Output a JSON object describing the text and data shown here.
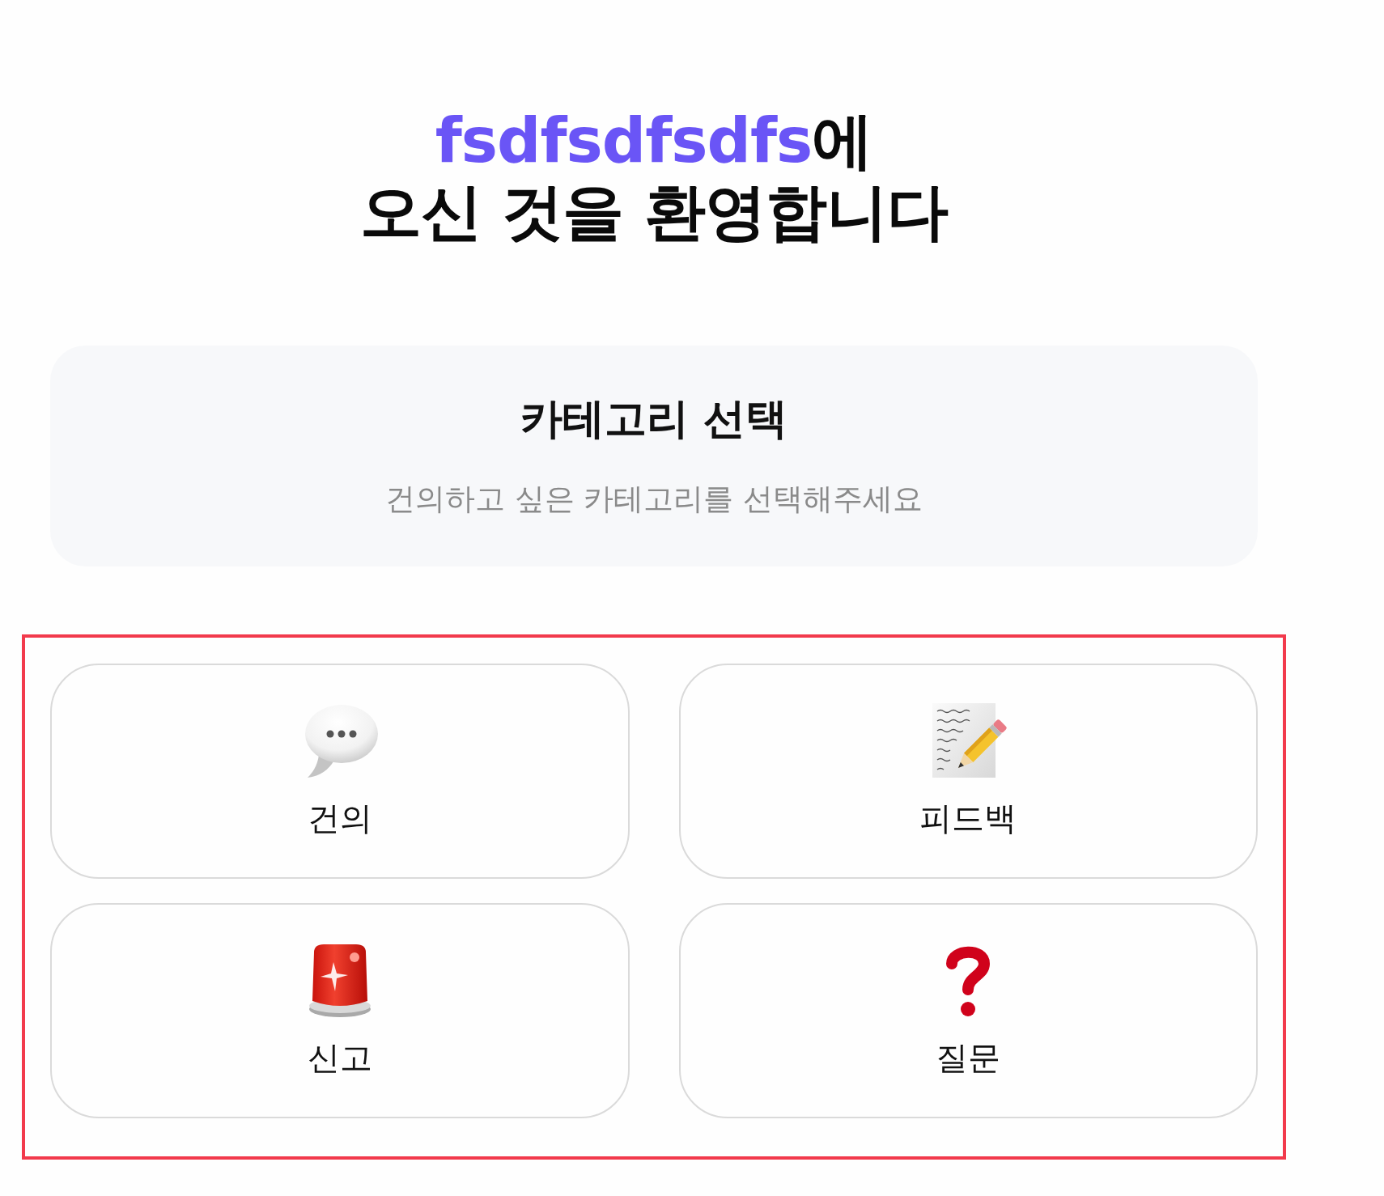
{
  "welcome": {
    "highlight": "fsdfsdfsdfs",
    "title_rest": "에",
    "title_line_2": "오신 것을 환영합니다"
  },
  "category_header": {
    "title": "카테고리 선택",
    "subtitle": "건의하고 싶은 카테고리를 선택해주세요"
  },
  "category_grid": {
    "highlighted": true,
    "categories": [
      {
        "label": "건의",
        "kind": "suggestion",
        "selected": false
      },
      {
        "label": "피드백",
        "kind": "feedback",
        "selected": false
      },
      {
        "label": "신고",
        "kind": "report",
        "selected": false
      },
      {
        "label": "질문",
        "kind": "question",
        "selected": false
      }
    ]
  }
}
